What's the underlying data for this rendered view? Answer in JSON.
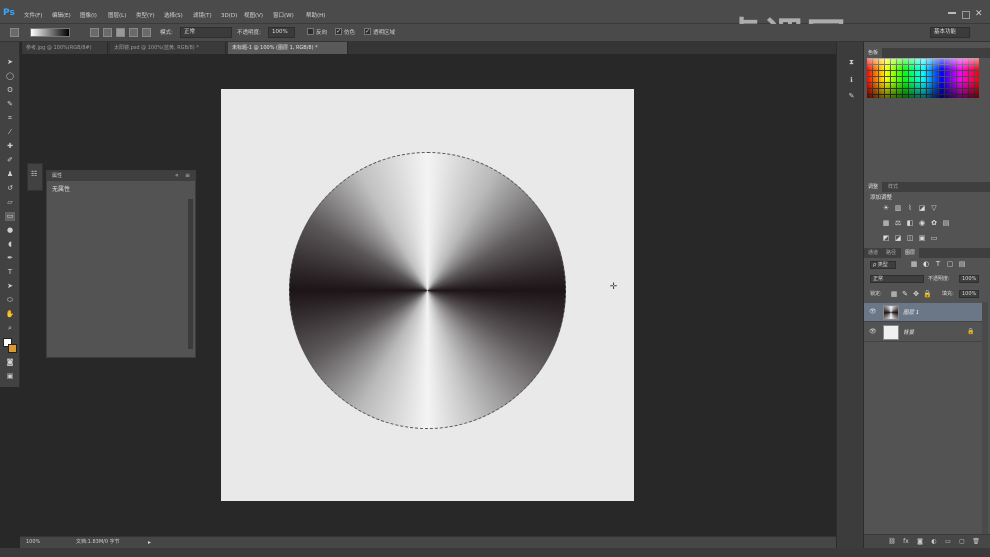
{
  "app": {
    "logo": "Ps"
  },
  "menu": [
    "文件(F)",
    "编辑(E)",
    "图像(I)",
    "图层(L)",
    "类型(Y)",
    "选择(S)",
    "滤镜(T)",
    "3D(D)",
    "视图(V)",
    "窗口(W)",
    "帮助(H)"
  ],
  "options": {
    "mode_label": "模式:",
    "mode_value": "正常",
    "opacity_label": "不透明度:",
    "opacity_value": "100%",
    "reverse_label": "反向",
    "dither_label": "仿色",
    "transparency_label": "透明区域"
  },
  "tabs": [
    {
      "label": "参考.jpg @ 100%(RGB/8#)"
    },
    {
      "label": "太阳镜.psd @ 100%(蓝黄, RGB/8) *"
    },
    {
      "label": "未标题-1 @ 100% (图层 1, RGB/8) *"
    }
  ],
  "properties": {
    "title": "属性",
    "subtitle": "无属性"
  },
  "status": {
    "zoom": "100%",
    "doc_info": "文档:1.83M/0 字节"
  },
  "right_panels": {
    "swatches_tab": "色板",
    "adjust_tabs": [
      "调整",
      "样式"
    ],
    "adjust_label": "添加调整",
    "layer_tabs": [
      "通道",
      "路径",
      "图层"
    ],
    "kind_label": "ρ 类型",
    "blend_value": "正常",
    "opacity_label": "不透明度:",
    "opacity_value": "100%",
    "lock_label": "锁定:",
    "fill_label": "填充:",
    "fill_value": "100%",
    "layers": [
      {
        "name": "图层 1"
      },
      {
        "name": "背景"
      }
    ]
  },
  "workspace_label": "基本功能",
  "watermark": "虎课网"
}
